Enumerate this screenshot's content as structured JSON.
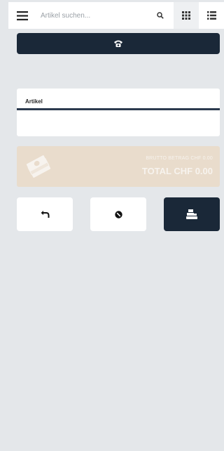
{
  "search": {
    "placeholder": "Artikel suchen..."
  },
  "icons": {
    "menu": "hamburger-menu-icon",
    "search": "magnifier-icon",
    "grid": "grid-view-icon",
    "list": "list-view-icon",
    "phone": "phone-icon",
    "money": "money-stack-icon",
    "undo": "undo-arrow-icon",
    "cancel": "cancel-circle-icon",
    "pay": "cash-register-icon"
  },
  "article": {
    "label": "Artikel"
  },
  "totals": {
    "brutto": "BRUTTO BETRAG CHF 0.00",
    "total": "TOTAL CHF 0.00"
  },
  "colors": {
    "background": "#e4e7ea",
    "dark": "#1a2838",
    "total_card": "#e9dccc"
  }
}
